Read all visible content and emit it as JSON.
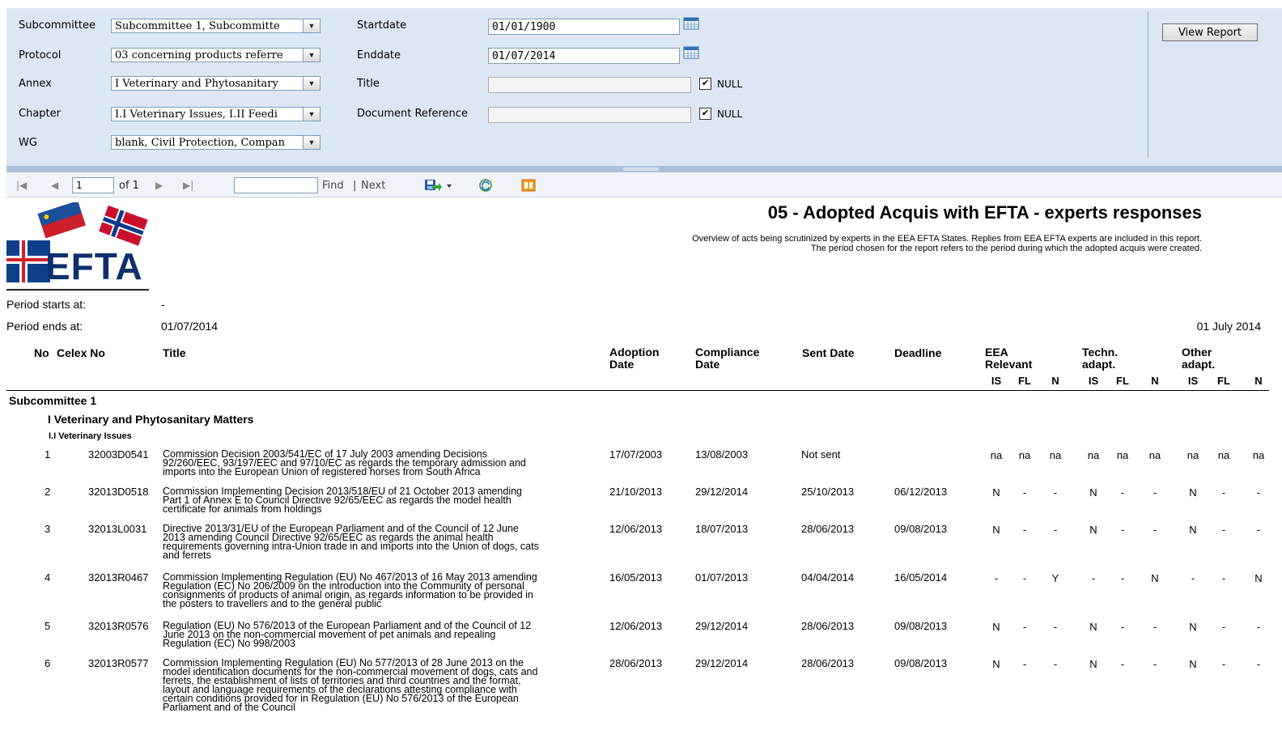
{
  "params": {
    "labels": [
      "Subcommittee",
      "Protocol",
      "Annex",
      "Chapter",
      "WG"
    ],
    "values": [
      "Subcommittee 1, Subcommitte",
      "03 concerning products referre",
      "I Veterinary and Phytosanitary",
      "I.I Veterinary Issues, I.II Feedi",
      "blank, Civil Protection, Compan"
    ],
    "startdate_label": "Startdate",
    "startdate": "01/01/1900",
    "enddate_label": "Enddate",
    "enddate": "01/07/2014",
    "title_label": "Title",
    "docref_label": "Document Reference",
    "null_label": "NULL",
    "view_report": "View Report"
  },
  "toolbar": {
    "page": "1",
    "of": "of 1",
    "find": "Find",
    "sep": "|",
    "next": "Next"
  },
  "report": {
    "title": "05 - Adopted Acquis with EFTA - experts responses",
    "subtitle1": "Overview of acts being scrutinized by experts in the EEA EFTA States. Replies from EEA EFTA experts are included in this report.",
    "subtitle2": "The period chosen for the report refers to the period during which the adopted acquis were created.",
    "logo_text": "EFTA",
    "period_starts_label": "Period starts at:",
    "period_starts": "-",
    "period_ends_label": "Period ends at:",
    "period_ends": "01/07/2014",
    "report_date": "01 July 2014",
    "columns": {
      "no": "No",
      "celex": "Celex No",
      "title": "Title",
      "adoption1": "Adoption",
      "adoption2": "Date",
      "compliance1": "Compliance",
      "compliance2": "Date",
      "sent": "Sent Date",
      "deadline": "Deadline",
      "eea1": "EEA",
      "eea2": "Relevant",
      "techn1": "Techn.",
      "techn2": "adapt.",
      "other1": "Other",
      "other2": "adapt.",
      "sub": [
        "IS",
        "FL",
        "N",
        "IS",
        "FL",
        "N",
        "IS",
        "FL",
        "N"
      ]
    },
    "group1": "Subcommittee 1",
    "group2": "I Veterinary and Phytosanitary Matters",
    "group3": "I.I Veterinary Issues",
    "rows": [
      {
        "no": "1",
        "celex": "32003D0541",
        "title": [
          "Commission Decision 2003/541/EC of 17 July 2003 amending Decisions",
          "92/260/EEC, 93/197/EEC and 97/10/EC as regards the temporary admission and",
          "imports into the European Union of registered horses from South Africa"
        ],
        "adoption": "17/07/2003",
        "compliance": "13/08/2003",
        "sent": "Not sent",
        "deadline": "",
        "flags": [
          "na",
          "na",
          "na",
          "na",
          "na",
          "na",
          "na",
          "na",
          "na"
        ]
      },
      {
        "no": "2",
        "celex": "32013D0518",
        "title": [
          "Commission Implementing Decision 2013/518/EU of 21 October 2013 amending",
          "Part 1 of Annex E to Council Directive 92/65/EEC as regards the model health",
          "certificate for animals from holdings"
        ],
        "adoption": "21/10/2013",
        "compliance": "29/12/2014",
        "sent": "25/10/2013",
        "deadline": "06/12/2013",
        "flags": [
          "N",
          "-",
          "-",
          "N",
          "-",
          "-",
          "N",
          "-",
          "-"
        ]
      },
      {
        "no": "3",
        "celex": "32013L0031",
        "title": [
          "Directive 2013/31/EU of the European Parliament and of the Council of 12 June",
          "2013 amending Council Directive 92/65/EEC as regards the animal health",
          "requirements governing intra-Union trade in and imports into the Union of dogs, cats",
          "and ferrets"
        ],
        "adoption": "12/06/2013",
        "compliance": "18/07/2013",
        "sent": "28/06/2013",
        "deadline": "09/08/2013",
        "flags": [
          "N",
          "-",
          "-",
          "N",
          "-",
          "-",
          "N",
          "-",
          "-"
        ]
      },
      {
        "no": "4",
        "celex": "32013R0467",
        "title": [
          "Commission Implementing Regulation (EU) No 467/2013 of 16 May 2013 amending",
          "Regulation (EC) No 206/2009 on the introduction into the Community of personal",
          "consignments of products of animal origin, as regards information to be provided in",
          "the posters to travellers and to the general public"
        ],
        "adoption": "16/05/2013",
        "compliance": "01/07/2013",
        "sent": "04/04/2014",
        "deadline": "16/05/2014",
        "flags": [
          "-",
          "-",
          "Y",
          "-",
          "-",
          "N",
          "-",
          "-",
          "N"
        ]
      },
      {
        "no": "5",
        "celex": "32013R0576",
        "title": [
          "Regulation (EU) No 576/2013 of the European Parliament and of the Council of 12",
          "June 2013 on the non-commercial movement of pet animals and repealing",
          "Regulation (EC) No 998/2003"
        ],
        "adoption": "12/06/2013",
        "compliance": "29/12/2014",
        "sent": "28/06/2013",
        "deadline": "09/08/2013",
        "flags": [
          "N",
          "-",
          "-",
          "N",
          "-",
          "-",
          "N",
          "-",
          "-"
        ]
      },
      {
        "no": "6",
        "celex": "32013R0577",
        "title": [
          "Commission Implementing Regulation (EU) No 577/2013 of 28 June 2013 on the",
          "model identification documents for the non-commercial movement of dogs, cats and",
          "ferrets, the establishment of lists of territories and third countries and the format,",
          "layout and language requirements of the declarations attesting compliance with",
          "certain conditions provided for in Regulation (EU) No 576/2013 of the European",
          "Parliament and of the Council"
        ],
        "adoption": "28/06/2013",
        "compliance": "29/12/2014",
        "sent": "28/06/2013",
        "deadline": "09/08/2013",
        "flags": [
          "N",
          "-",
          "-",
          "N",
          "-",
          "-",
          "N",
          "-",
          "-"
        ]
      }
    ]
  }
}
